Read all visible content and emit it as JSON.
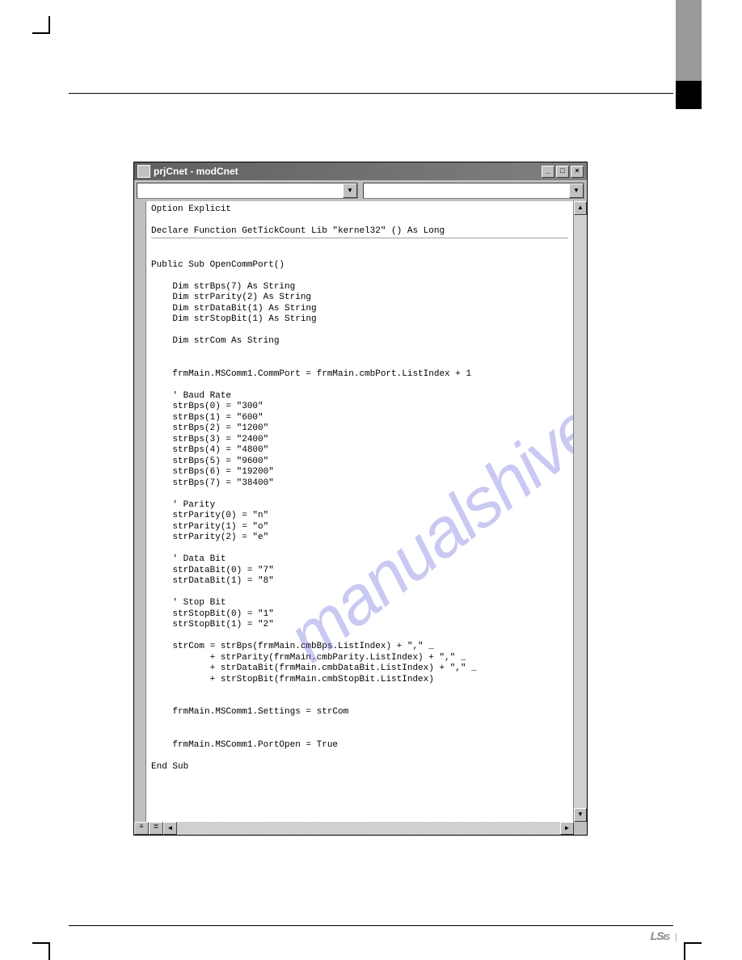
{
  "window": {
    "title": "prjCnet - modCnet",
    "minimize": "_",
    "maximize": "□",
    "close": "×"
  },
  "code": {
    "line1": "Option Explicit",
    "line2": "Declare Function GetTickCount Lib \"kernel32\" () As Long",
    "body": "Public Sub OpenCommPort()\n\n    Dim strBps(7) As String\n    Dim strParity(2) As String\n    Dim strDataBit(1) As String\n    Dim strStopBit(1) As String\n\n    Dim strCom As String\n\n\n    frmMain.MSComm1.CommPort = frmMain.cmbPort.ListIndex + 1\n\n    ' Baud Rate\n    strBps(0) = \"300\"\n    strBps(1) = \"600\"\n    strBps(2) = \"1200\"\n    strBps(3) = \"2400\"\n    strBps(4) = \"4800\"\n    strBps(5) = \"9600\"\n    strBps(6) = \"19200\"\n    strBps(7) = \"38400\"\n\n    ' Parity\n    strParity(0) = \"n\"\n    strParity(1) = \"o\"\n    strParity(2) = \"e\"\n\n    ' Data Bit\n    strDataBit(0) = \"7\"\n    strDataBit(1) = \"8\"\n\n    ' Stop Bit\n    strStopBit(0) = \"1\"\n    strStopBit(1) = \"2\"\n\n    strCom = strBps(frmMain.cmbBps.ListIndex) + \",\" _\n           + strParity(frmMain.cmbParity.ListIndex) + \",\" _\n           + strDataBit(frmMain.cmbDataBit.ListIndex) + \",\" _\n           + strStopBit(frmMain.cmbStopBit.ListIndex)\n\n\n    frmMain.MSComm1.Settings = strCom\n\n\n    frmMain.MSComm1.PortOpen = True\n\nEnd Sub"
  },
  "watermark": "manualshive.com",
  "footer": {
    "logo": "LS",
    "logo_suffix": "IS",
    "bar": "|"
  },
  "scroll": {
    "up": "▲",
    "down": "▼",
    "left": "◄",
    "right": "►",
    "dropdown": "▼"
  }
}
